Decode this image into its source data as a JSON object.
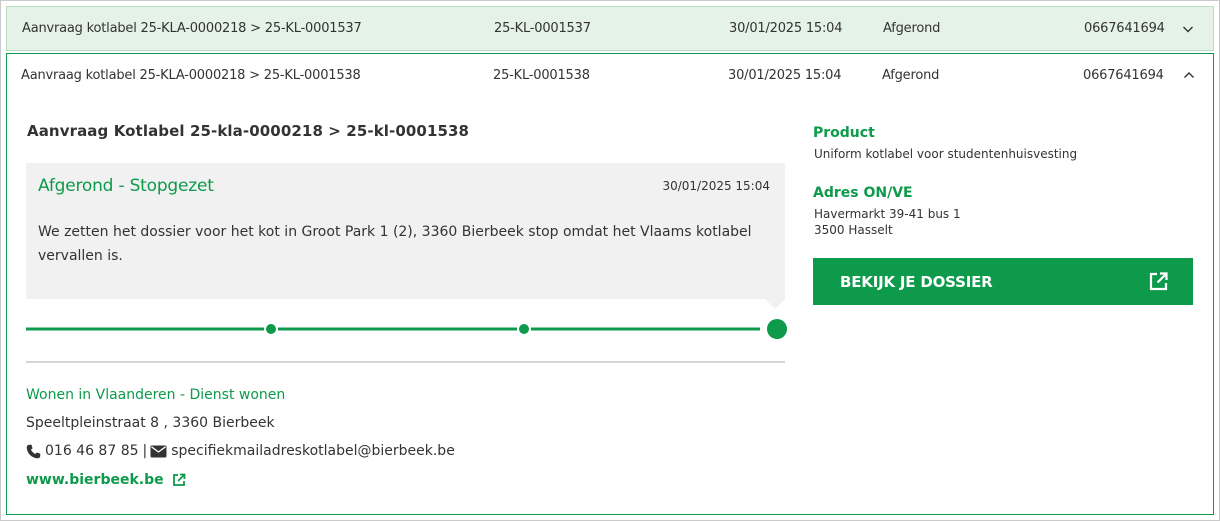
{
  "rows": [
    {
      "title": "Aanvraag kotlabel 25-KLA-0000218 > 25-KL-0001537",
      "id": "25-KL-0001537",
      "date": "30/01/2025 15:04",
      "status": "Afgerond",
      "number": "0667641694",
      "expanded": false
    },
    {
      "title": "Aanvraag kotlabel 25-KLA-0000218 > 25-KL-0001538",
      "id": "25-KL-0001538",
      "date": "30/01/2025 15:04",
      "status": "Afgerond",
      "number": "0667641694",
      "expanded": true
    }
  ],
  "detail": {
    "title": "Aanvraag Kotlabel 25-kla-0000218 > 25-kl-0001538",
    "message": {
      "status": "Afgerond - Stopgezet",
      "date": "30/01/2025 15:04",
      "text": "We zetten het dossier voor het kot in Groot Park 1 (2), 3360 Bierbeek stop omdat het Vlaams kotlabel vervallen is."
    },
    "timeline": {
      "steps": 4,
      "current_step": 4
    },
    "contact": {
      "organisation": "Wonen in Vlaanderen - Dienst wonen",
      "address": "Speeltpleinstraat 8 , 3360 Bierbeek",
      "phone": "016 46 87 85",
      "separator": "|",
      "email": "specifiekmailadreskotlabel@bierbeek.be",
      "website": "www.bierbeek.be"
    },
    "sidebar": {
      "product_label": "Product",
      "product_value": "Uniform kotlabel voor studentenhuisvesting",
      "address_label": "Adres ON/VE",
      "address_line1": "Havermarkt 39-41 bus 1",
      "address_line2": "3500 Hasselt",
      "button_label": "BEKIJK JE DOSSIER"
    }
  },
  "colors": {
    "accent": "#0d9a4a",
    "row_highlight": "#e5f2e8",
    "message_bg": "#f1f1f1",
    "text": "#333332"
  },
  "icons": {
    "collapsed_chevron": "chevron-down-icon",
    "expanded_chevron": "chevron-up-icon",
    "phone": "phone-icon",
    "email": "envelope-icon",
    "external": "external-link-icon"
  }
}
